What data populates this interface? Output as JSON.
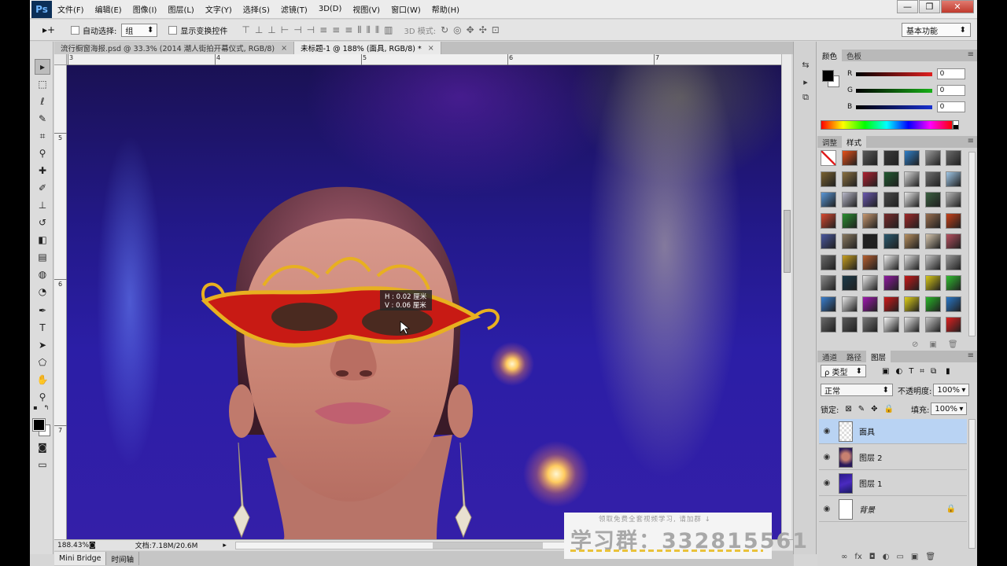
{
  "app": {
    "logo": "Ps"
  },
  "menu": [
    "文件(F)",
    "编辑(E)",
    "图像(I)",
    "图层(L)",
    "文字(Y)",
    "选择(S)",
    "滤镜(T)",
    "3D(D)",
    "视图(V)",
    "窗口(W)",
    "帮助(H)"
  ],
  "window_controls": {
    "minimize": "—",
    "maximize": "❐",
    "close": "✕"
  },
  "options": {
    "auto_select_label": "自动选择:",
    "auto_select_value": "组",
    "show_transform_label": "显示变换控件",
    "mode_3d_label": "3D 模式:",
    "workspace": "基本功能"
  },
  "doc_tabs": [
    {
      "title": "流行橱窗海报.psd @ 33.3% (2014 潮人街拍开幕仪式, RGB/8)",
      "close": "×"
    },
    {
      "title": "未标题-1 @ 188% (面具, RGB/8) *",
      "close": "×"
    }
  ],
  "ruler": {
    "h": [
      "3",
      "4",
      "5",
      "6",
      "7"
    ],
    "v": [
      "5",
      "6",
      "7"
    ]
  },
  "tooltip": {
    "line1": "H : 0.02 厘米",
    "line2": "V : 0.06 厘米"
  },
  "status": {
    "zoom": "188.43%",
    "doc": "文档:7.18M/20.6M"
  },
  "bottom_tabs": [
    "Mini Bridge",
    "时间轴"
  ],
  "color_panel": {
    "tabs": [
      "颜色",
      "色板"
    ],
    "channels": [
      {
        "label": "R",
        "value": "0",
        "color": "#e02020"
      },
      {
        "label": "G",
        "value": "0",
        "color": "#18b018"
      },
      {
        "label": "B",
        "value": "0",
        "color": "#1830d0"
      }
    ]
  },
  "styles_panel": {
    "tabs": [
      "调整",
      "样式"
    ],
    "tiles": [
      "#ffffff",
      "#e85018",
      "#5a5a5a",
      "#3a3a3a",
      "#2f7fc8",
      "#9a9a9a",
      "#6a6a6a",
      "#7a6230",
      "#8a7040",
      "#b02030",
      "#205a30",
      "#d8d8d8",
      "#707070",
      "#a0c8e8",
      "#5a98d8",
      "#b8b8c8",
      "#6a58b0",
      "#4a4a4a",
      "#e8e8e8",
      "#3a6040",
      "#b8b8b8",
      "#d84830",
      "#2a9030",
      "#c89870",
      "#7a2a2a",
      "#a02828",
      "#9a7050",
      "#c84018",
      "#4a58a0",
      "#8a7a60",
      "#222222",
      "#2a5a70",
      "#b89060",
      "#d8c8b0",
      "#b85060",
      "#6a6a6a",
      "#c8a020",
      "#b86030",
      "#f0f0f0",
      "#e0e0e0",
      "#c8c8c8",
      "#9a9a9a",
      "#8a8a8a",
      "#1a3a4a",
      "#e8e8e8",
      "#9018a0",
      "#c81818",
      "#d8c818",
      "#30c030",
      "#3a80d0",
      "#e8e8e8",
      "#a018b0",
      "#d01818",
      "#e0d018",
      "#28b828",
      "#2a78c8",
      "#6a6a6a",
      "#5a5a5a",
      "#7a7a7a",
      "#f8f8f8",
      "#e8e8e8",
      "#c8c8c8",
      "#e02020"
    ]
  },
  "layers_panel": {
    "tabs": [
      "通道",
      "路径",
      "图层"
    ],
    "filter": "ρ 类型",
    "blend_mode": "正常",
    "opacity_label": "不透明度:",
    "opacity": "100%",
    "lock_label": "锁定:",
    "fill_label": "填充:",
    "fill": "100%",
    "layers": [
      {
        "name": "面具",
        "selected": true
      },
      {
        "name": "图层 2",
        "selected": false
      },
      {
        "name": "图层 1",
        "selected": false
      },
      {
        "name": "背景",
        "selected": false,
        "locked": true
      }
    ],
    "bottom_icons": [
      "∞",
      "fx",
      "◘",
      "◐",
      "▭",
      "▣",
      "🗑"
    ]
  },
  "watermark": {
    "small": "领取免费全套视频学习, 请加群 ↓",
    "big": "学习群：332815561"
  }
}
